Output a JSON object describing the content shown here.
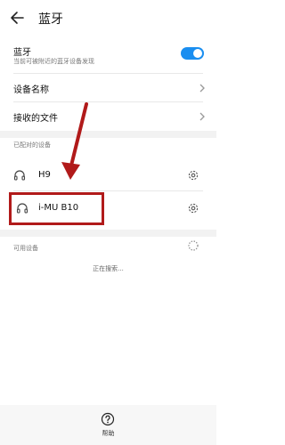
{
  "header": {
    "title": "蓝牙",
    "back_icon": "arrow-left-icon"
  },
  "bluetooth": {
    "label": "蓝牙",
    "subtitle": "当前可被附近的蓝牙设备发现",
    "toggle_on": true,
    "accent": "#1a8ef0"
  },
  "device_name": {
    "label": "设备名称"
  },
  "received_files": {
    "label": "接收的文件"
  },
  "paired": {
    "section_title": "已配对的设备",
    "devices": [
      {
        "name": "H9",
        "icon": "headphones-icon",
        "settings_icon": "gear-icon"
      },
      {
        "name": "i-MU B10",
        "icon": "headphones-icon",
        "settings_icon": "gear-icon"
      }
    ]
  },
  "available": {
    "section_title": "可用设备",
    "status": "正在搜索..."
  },
  "bottom": {
    "help_label": "帮助",
    "help_icon": "question-circle-icon"
  },
  "annotation": {
    "color": "#b11a1a"
  }
}
